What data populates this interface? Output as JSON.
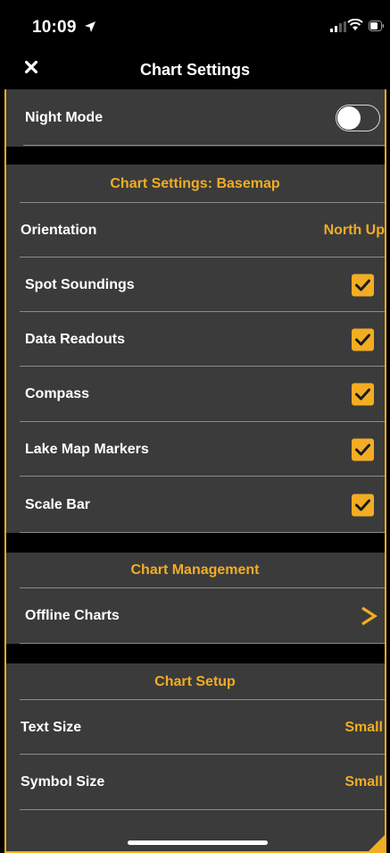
{
  "status_bar": {
    "time": "10:09",
    "icons": [
      "location-arrow-icon",
      "signal-icon",
      "wifi-icon",
      "battery-icon"
    ]
  },
  "nav": {
    "title": "Chart Settings",
    "close_icon": "close-icon"
  },
  "night_mode": {
    "label": "Night Mode",
    "enabled": false
  },
  "basemap": {
    "header": "Chart Settings: Basemap",
    "orientation": {
      "label": "Orientation",
      "value": "North Up"
    },
    "items": [
      {
        "label": "Spot Soundings",
        "checked": true
      },
      {
        "label": "Data Readouts",
        "checked": true
      },
      {
        "label": "Compass",
        "checked": true
      },
      {
        "label": "Lake Map Markers",
        "checked": true
      },
      {
        "label": "Scale Bar",
        "checked": true
      }
    ]
  },
  "management": {
    "header": "Chart Management",
    "offline": {
      "label": "Offline Charts",
      "icon": "chevron-right-icon"
    }
  },
  "setup": {
    "header": "Chart Setup",
    "text_size": {
      "label": "Text Size",
      "value": "Small"
    },
    "symbol_size": {
      "label": "Symbol Size",
      "value": "Small"
    }
  },
  "colors": {
    "accent": "#f2ad22",
    "row_background": "#3b3b3c",
    "background": "#000000"
  }
}
